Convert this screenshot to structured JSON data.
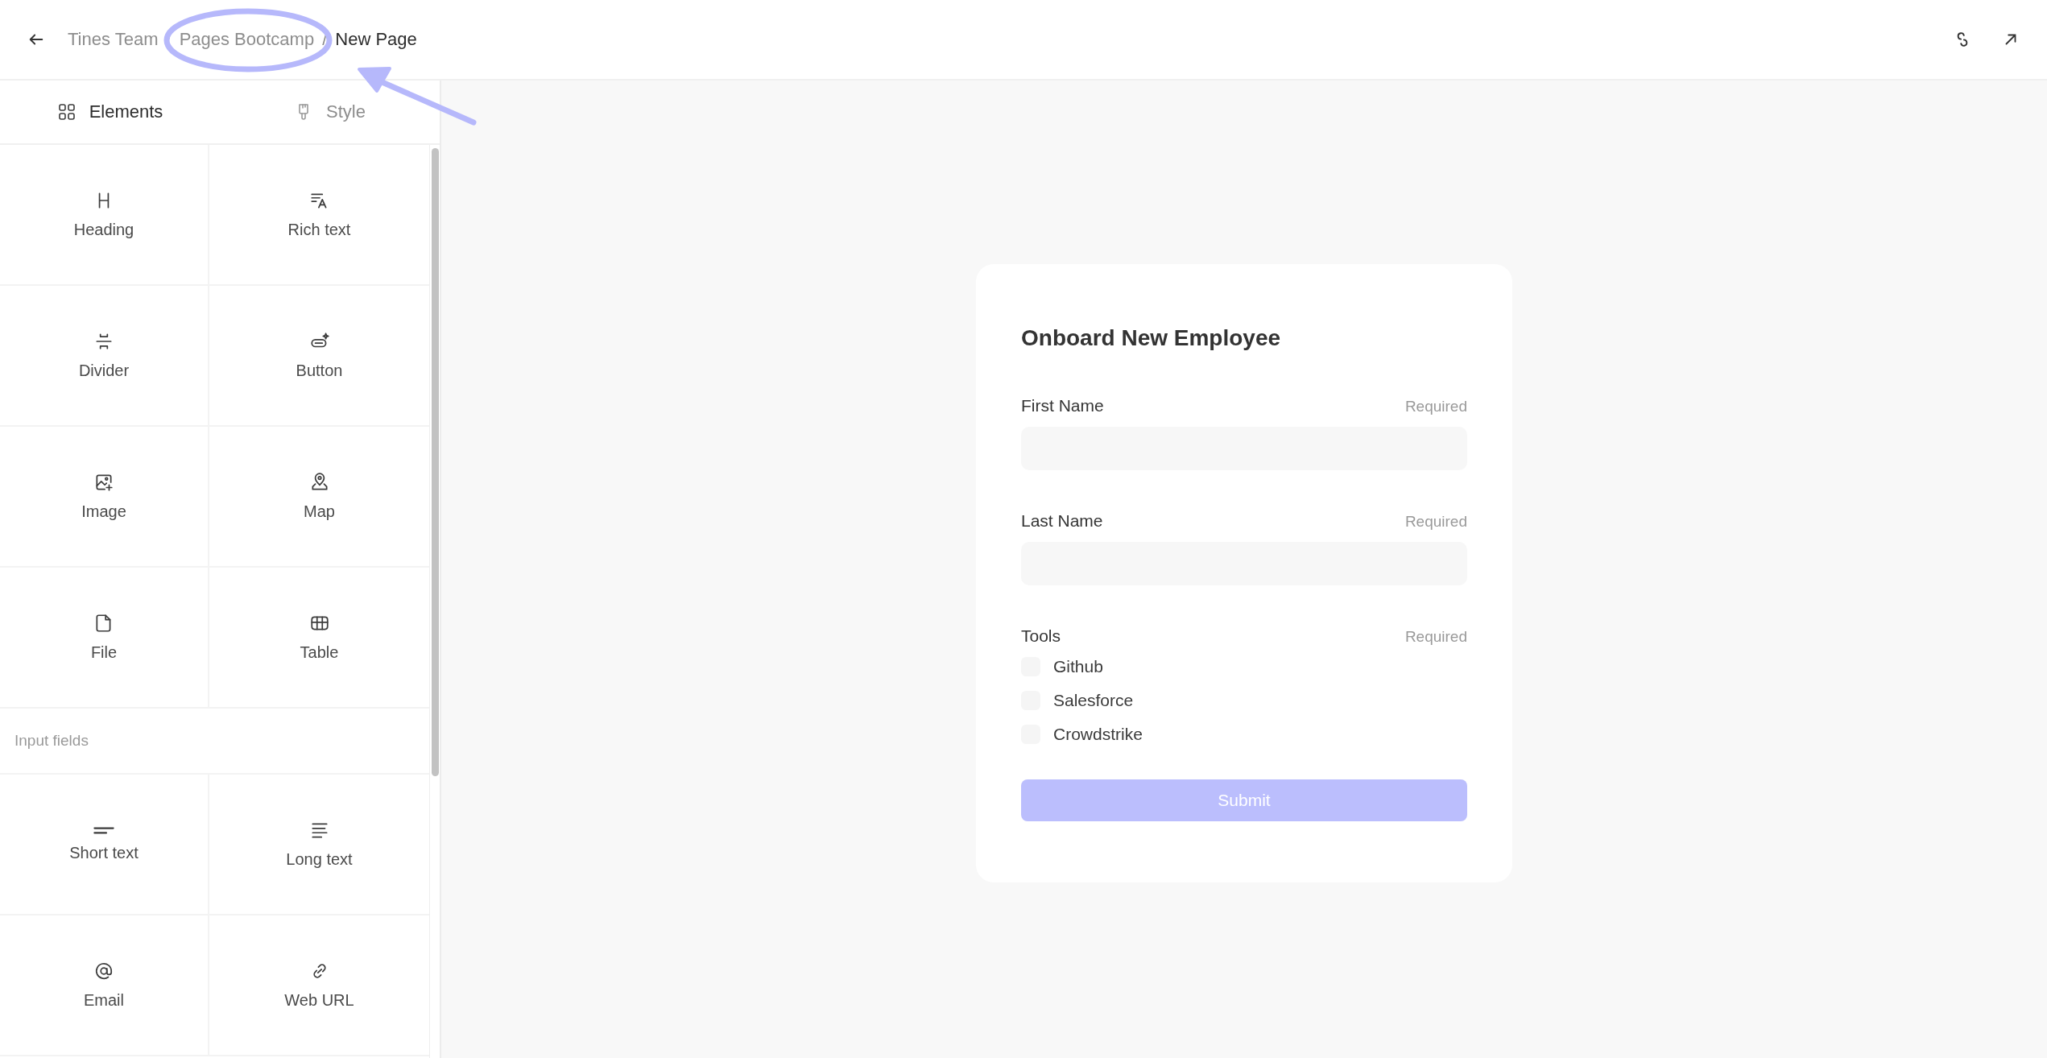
{
  "breadcrumb": [
    {
      "label": "Tines Team",
      "current": false
    },
    {
      "label": "Pages Bootcamp",
      "current": false
    },
    {
      "label": "New Page",
      "current": true
    }
  ],
  "separator": "/",
  "sidebar": {
    "tabs": [
      {
        "label": "Elements",
        "kind": "grid",
        "selected": true
      },
      {
        "label": "Style",
        "kind": "brush",
        "selected": false
      }
    ],
    "groups": [
      {
        "items": [
          {
            "label": "Heading",
            "kind": "heading"
          },
          {
            "label": "Rich text",
            "kind": "richtext"
          },
          {
            "label": "Divider",
            "kind": "divider"
          },
          {
            "label": "Button",
            "kind": "button"
          },
          {
            "label": "Image",
            "kind": "image"
          },
          {
            "label": "Map",
            "kind": "map"
          },
          {
            "label": "File",
            "kind": "file"
          },
          {
            "label": "Table",
            "kind": "table"
          }
        ]
      },
      {
        "title": "Input fields",
        "items": [
          {
            "label": "Short text",
            "kind": "short"
          },
          {
            "label": "Long text",
            "kind": "long"
          },
          {
            "label": "Email",
            "kind": "email"
          },
          {
            "label": "Web URL",
            "kind": "url"
          }
        ]
      }
    ]
  },
  "form": {
    "title": "Onboard New Employee",
    "fields": [
      {
        "label": "First Name",
        "hint": "Required",
        "kind": "text"
      },
      {
        "label": "Last Name",
        "hint": "Required",
        "kind": "text"
      },
      {
        "label": "Tools",
        "hint": "Required",
        "kind": "checkboxes",
        "options": [
          {
            "label": "Github",
            "checked": false
          },
          {
            "label": "Salesforce",
            "checked": false
          },
          {
            "label": "Crowdstrike",
            "checked": false
          }
        ]
      }
    ],
    "submit": {
      "label": "Submit",
      "disabled": true
    }
  }
}
